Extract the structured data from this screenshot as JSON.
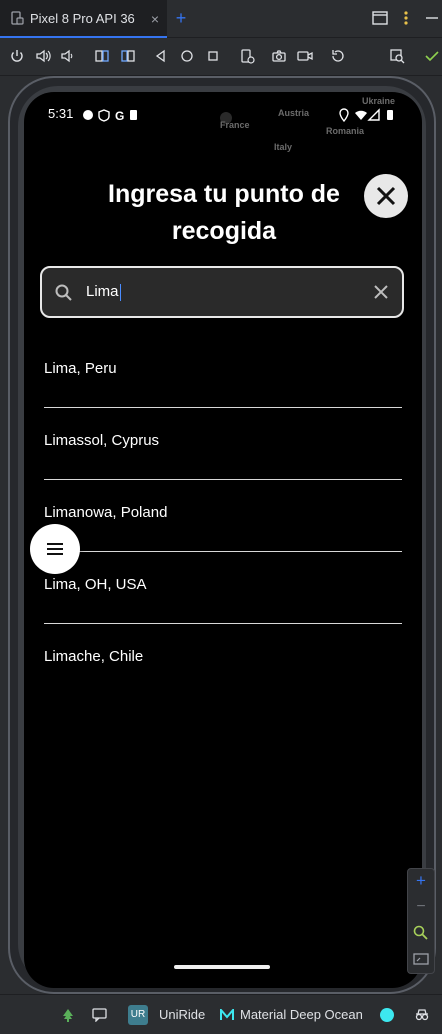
{
  "ide": {
    "tab_title": "Pixel 8 Pro API 36",
    "tab_close": "×",
    "add_tab": "+"
  },
  "device": {
    "status_time": "5:31",
    "map_labels": [
      "France",
      "Austria",
      "Ukraine",
      "Romania",
      "Italy"
    ]
  },
  "screen": {
    "title": "Ingresa tu punto de recogida",
    "search": {
      "value": "Lima"
    },
    "results": [
      {
        "label": "Lima, Peru"
      },
      {
        "label": "Limassol, Cyprus"
      },
      {
        "label": "Limanowa, Poland"
      },
      {
        "label": "Lima, OH, USA"
      },
      {
        "label": "Limache, Chile"
      }
    ]
  },
  "emulator_side": {
    "zoom_in": "+",
    "zoom_out": "−"
  },
  "ide_status": {
    "project_badge": "UR",
    "project_name": "UniRide",
    "theme_name": "Material Deep Ocean"
  },
  "colors": {
    "accent": "#3574f0",
    "background": "#000000",
    "ide_bg": "#2b2d30"
  }
}
